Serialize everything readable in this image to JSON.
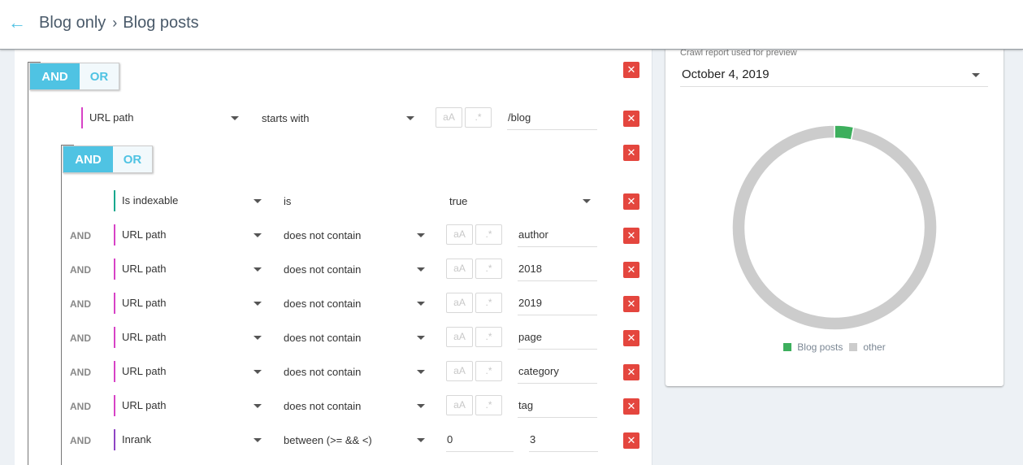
{
  "header": {
    "back_icon": "arrow-left-icon",
    "breadcrumb": [
      "Blog only",
      "Blog posts"
    ],
    "separator": "›"
  },
  "filter": {
    "outer_group": {
      "and_label": "AND",
      "or_label": "OR",
      "active": "AND",
      "rule": {
        "field": "URL path",
        "field_color": "#d742c6",
        "operator": "starts with",
        "case_flag": "aA",
        "regex_flag": ".*",
        "value": "/blog"
      }
    },
    "inner_group": {
      "and_label": "AND",
      "or_label": "OR",
      "active": "AND",
      "rules": [
        {
          "conj": "",
          "field": "Is indexable",
          "field_color": "#16a88e",
          "operator": "is",
          "value": "true",
          "value_type": "select"
        },
        {
          "conj": "AND",
          "field": "URL path",
          "field_color": "#d742c6",
          "operator": "does not contain",
          "case_flag": "aA",
          "regex_flag": ".*",
          "value": "author",
          "value_type": "text"
        },
        {
          "conj": "AND",
          "field": "URL path",
          "field_color": "#d742c6",
          "operator": "does not contain",
          "case_flag": "aA",
          "regex_flag": ".*",
          "value": "2018",
          "value_type": "text"
        },
        {
          "conj": "AND",
          "field": "URL path",
          "field_color": "#d742c6",
          "operator": "does not contain",
          "case_flag": "aA",
          "regex_flag": ".*",
          "value": "2019",
          "value_type": "text"
        },
        {
          "conj": "AND",
          "field": "URL path",
          "field_color": "#d742c6",
          "operator": "does not contain",
          "case_flag": "aA",
          "regex_flag": ".*",
          "value": "page",
          "value_type": "text"
        },
        {
          "conj": "AND",
          "field": "URL path",
          "field_color": "#d742c6",
          "operator": "does not contain",
          "case_flag": "aA",
          "regex_flag": ".*",
          "value": "category",
          "value_type": "text"
        },
        {
          "conj": "AND",
          "field": "URL path",
          "field_color": "#d742c6",
          "operator": "does not contain",
          "case_flag": "aA",
          "regex_flag": ".*",
          "value": "tag",
          "value_type": "text"
        },
        {
          "conj": "AND",
          "field": "Inrank",
          "field_color": "#8e44c4",
          "operator": "between (>= && <)",
          "value_min": "0",
          "value_max": "3",
          "value_type": "range"
        }
      ]
    },
    "delete_icon": "close-icon"
  },
  "preview": {
    "crawl_label": "Crawl report used for preview",
    "crawl_date": "October 4, 2019",
    "legend": [
      {
        "label": "Blog posts",
        "color": "#3daf5d"
      },
      {
        "label": "other",
        "color": "#cccccc"
      }
    ]
  },
  "chart_data": {
    "type": "pie",
    "subtype": "donut",
    "categories": [
      "Blog posts",
      "other"
    ],
    "values": [
      3,
      97
    ],
    "colors": [
      "#3daf5d",
      "#cccccc"
    ],
    "title": "",
    "legend": "bottom"
  }
}
